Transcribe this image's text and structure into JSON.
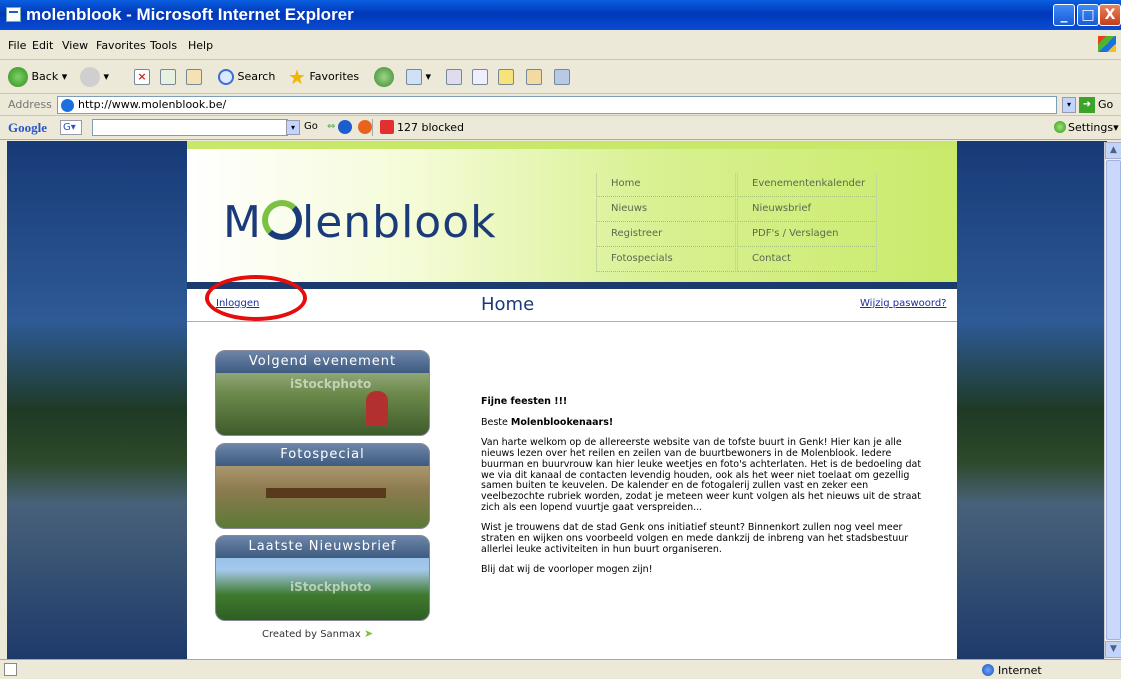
{
  "window": {
    "title": "molenblook - Microsoft Internet Explorer",
    "buttons": {
      "minimize": "_",
      "maximize": "□",
      "close": "X"
    }
  },
  "menu": [
    "File",
    "Edit",
    "View",
    "Favorites",
    "Tools",
    "Help"
  ],
  "toolbar": {
    "back": "Back",
    "search": "Search",
    "favorites": "Favorites"
  },
  "address": {
    "label": "Address",
    "url": "http://www.molenblook.be/",
    "go": "Go"
  },
  "google_bar": {
    "brand": "Google",
    "go": "Go",
    "blocked": "127 blocked",
    "settings": "Settings"
  },
  "site": {
    "logo": {
      "before": "M",
      "after": "lenblook"
    },
    "nav": [
      [
        "Home",
        "Evenementenkalender"
      ],
      [
        "Nieuws",
        "Nieuwsbrief"
      ],
      [
        "Registreer",
        "PDF's / Verslagen"
      ],
      [
        "Fotospecials",
        "Contact"
      ]
    ],
    "login_link": "Inloggen",
    "page_title": "Home",
    "change_password_link": "Wijzig paswoord?",
    "side_buttons": [
      {
        "label": "Volgend evenement",
        "watermark": "iStockphoto"
      },
      {
        "label": "Fotospecial",
        "watermark": ""
      },
      {
        "label": "Laatste Nieuwsbrief",
        "watermark": "iStockphoto"
      }
    ],
    "credit": "Created by Sanmax",
    "content": {
      "heading": "Fijne feesten !!!",
      "greeting_prefix": "Beste ",
      "greeting_bold": "Molenblookenaars!",
      "paragraph1": "Van harte welkom op de allereerste website van de tofste buurt in Genk! Hier kan je alle nieuws lezen over het reilen en zeilen van de buurtbewoners in de Molenblook. Iedere buurman en buurvrouw kan hier leuke weetjes en foto's achterlaten. Het is de bedoeling dat we via dit kanaal de contacten levendig houden, ook als het weer niet toelaat om gezellig samen buiten te keuvelen. De kalender en de fotogalerij zullen vast en zeker een veelbezochte rubriek worden, zodat je meteen weer kunt volgen als het nieuws uit de straat zich als een lopend vuurtje gaat verspreiden...",
      "paragraph2": "Wist je trouwens dat de stad Genk ons initiatief steunt? Binnenkort zullen nog veel meer straten en wijken ons voorbeeld volgen en mede dankzij de inbreng van het stadsbestuur allerlei leuke activiteiten in hun buurt organiseren.",
      "paragraph3": "Blij dat wij de voorloper mogen zijn!"
    }
  },
  "status": {
    "zone": "Internet"
  },
  "colors": {
    "accent": "#1b3a7a",
    "highlight": "#e60d0d",
    "header_green": "#c9ea6a"
  }
}
